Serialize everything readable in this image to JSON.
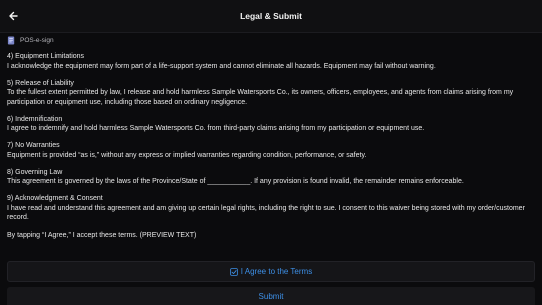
{
  "header": {
    "title": "Legal & Submit",
    "back_icon": "arrow-left-icon"
  },
  "source": {
    "icon": "document-icon",
    "label": "POS-e-sign"
  },
  "sections": [
    {
      "title": "4) Equipment Limitations",
      "body": "I acknowledge the equipment may form part of a life-support system and cannot eliminate all hazards. Equipment may fail without warning."
    },
    {
      "title": "5) Release of Liability",
      "body": "To the fullest extent permitted by law, I release and hold harmless Sample Watersports Co., its owners, officers, employees, and agents from claims arising from my participation or equipment use, including those based on ordinary negligence."
    },
    {
      "title": "6) Indemnification",
      "body": "I agree to indemnify and hold harmless Sample Watersports Co. from third-party claims arising from my participation or equipment use."
    },
    {
      "title": "7) No Warranties",
      "body": "Equipment is provided “as is,” without any express or implied warranties regarding condition, performance, or safety."
    },
    {
      "title": "8) Governing Law",
      "body": "This agreement is governed by the laws of the Province/State of ___________. If any provision is found invalid, the remainder remains enforceable."
    },
    {
      "title": "9) Acknowledgment & Consent",
      "body": "I have read and understand this agreement and am giving up certain legal rights, including the right to sue. I consent to this waiver being stored with my order/customer record."
    }
  ],
  "closing": "By tapping “I Agree,” I accept these terms. (PREVIEW TEXT)",
  "actions": {
    "agree_icon": "checkbox-icon",
    "agree_label": "I Agree to the Terms",
    "submit_label": "Submit",
    "accent_color": "#3d8fe6"
  }
}
